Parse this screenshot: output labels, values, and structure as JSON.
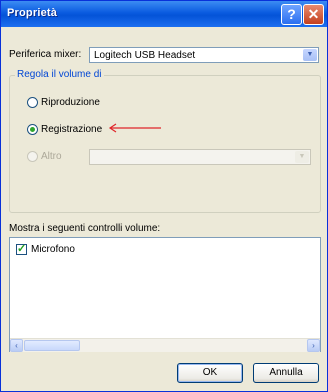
{
  "window": {
    "title": "Proprietà",
    "help_glyph": "?",
    "close_glyph": "✕"
  },
  "mixer": {
    "label": "Periferica mixer:",
    "value": "Logitech USB Headset"
  },
  "volume_group": {
    "title": "Regola il volume di",
    "options": [
      {
        "label": "Riproduzione",
        "checked": false,
        "enabled": true
      },
      {
        "label": "Registrazione",
        "checked": true,
        "enabled": true
      },
      {
        "label": "Altro",
        "checked": false,
        "enabled": false
      }
    ],
    "altro_combo_value": ""
  },
  "controls": {
    "label": "Mostra i seguenti controlli volume:",
    "items": [
      {
        "label": "Microfono",
        "checked": true
      }
    ]
  },
  "scrollbar": {
    "left_glyph": "‹",
    "right_glyph": "›"
  },
  "buttons": {
    "ok": "OK",
    "cancel": "Annulla"
  },
  "colors": {
    "title_bar": "#0453d8",
    "group_title": "#0046d5",
    "annotation_arrow": "#e0262a",
    "radio_checked": "#2fa52f"
  }
}
